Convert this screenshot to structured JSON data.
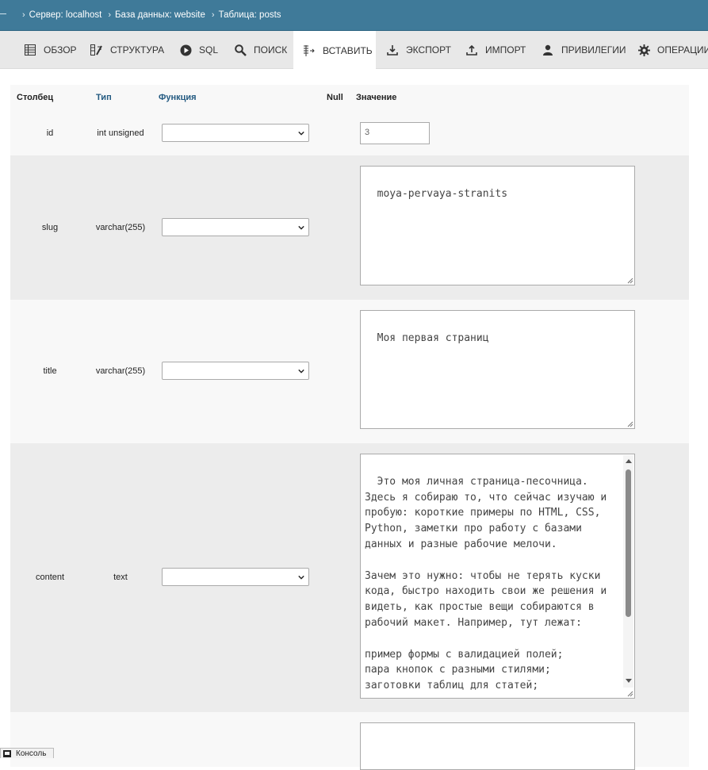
{
  "breadcrumb": {
    "items": [
      {
        "label": "Сервер: localhost"
      },
      {
        "label": "База данных: website"
      },
      {
        "label": "Таблица: posts"
      }
    ]
  },
  "tabs": [
    {
      "label": "Обзор",
      "icon": "browse-icon"
    },
    {
      "label": "Структура",
      "icon": "structure-icon"
    },
    {
      "label": "SQL",
      "icon": "sql-icon"
    },
    {
      "label": "Поиск",
      "icon": "search-icon"
    },
    {
      "label": "Вставить",
      "icon": "insert-icon",
      "active": true
    },
    {
      "label": "Экспорт",
      "icon": "export-icon"
    },
    {
      "label": "Импорт",
      "icon": "import-icon"
    },
    {
      "label": "Привилегии",
      "icon": "user-icon"
    },
    {
      "label": "Операции",
      "icon": "gear-icon"
    }
  ],
  "table": {
    "headers": {
      "column": "Столбец",
      "type": "Тип",
      "function": "Функция",
      "null": "Null",
      "value": "Значение"
    },
    "rows": [
      {
        "name": "id",
        "type": "int unsigned",
        "function": "",
        "value": "3"
      },
      {
        "name": "slug",
        "type": "varchar(255)",
        "function": "",
        "value": "moya-pervaya-stranits"
      },
      {
        "name": "title",
        "type": "varchar(255)",
        "function": "",
        "value": "Моя первая страниц"
      },
      {
        "name": "content",
        "type": "text",
        "function": "",
        "value": "Это моя личная страница-песочница. Здесь я собираю то, что сейчас изучаю и пробую: короткие примеры по HTML, CSS, Python, заметки про работу с базами данных и разные рабочие мелочи.\n\nЗачем это нужно: чтобы не терять куски кода, быстро находить свои же решения и видеть, как простые вещи собираются в рабочий макет. Например, тут лежат:\n\nпример формы с валидацией полей;\nпара кнопок с разными стилями;\nзаготовки таблиц для статей;\nмаленькие скрипты, которые реально"
      },
      {
        "name": "",
        "type": "",
        "function": "",
        "value": ""
      }
    ]
  },
  "console": {
    "label": "Консоль"
  }
}
